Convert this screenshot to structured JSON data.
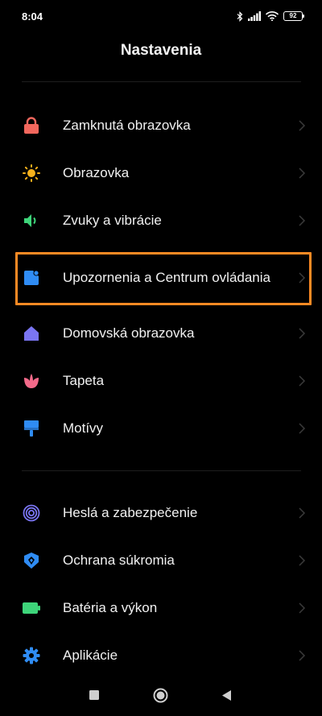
{
  "status_bar": {
    "time": "8:04",
    "battery_level": "92",
    "icons": [
      "bluetooth-icon",
      "signal-icon",
      "wifi-icon",
      "battery-icon"
    ]
  },
  "page_title": "Nastavenia",
  "groups": [
    {
      "items": [
        {
          "label": "Zamknutá obrazovka",
          "icon": "lock-icon",
          "icon_color": "#f2675d"
        },
        {
          "label": "Obrazovka",
          "icon": "sun-icon",
          "icon_color": "#f7b21c"
        },
        {
          "label": "Zvuky a vibrácie",
          "icon": "speaker-icon",
          "icon_color": "#3ed57a"
        },
        {
          "label": "Upozornenia a Centrum ovládania",
          "icon": "notification-icon",
          "icon_color": "#2f8cf4"
        },
        {
          "label": "Domovská obrazovka",
          "icon": "home-icon",
          "icon_color": "#7a75f2"
        },
        {
          "label": "Tapeta",
          "icon": "tulip-icon",
          "icon_color": "#f36a8a"
        },
        {
          "label": "Motívy",
          "icon": "brush-icon",
          "icon_color": "#2f8cf4"
        }
      ]
    },
    {
      "items": [
        {
          "label": "Heslá a zabezpečenie",
          "icon": "fingerprint-icon",
          "icon_color": "#7a75f2"
        },
        {
          "label": "Ochrana súkromia",
          "icon": "privacy-shield-icon",
          "icon_color": "#2f8cf4"
        },
        {
          "label": "Batéria a výkon",
          "icon": "battery-performance-icon",
          "icon_color": "#3ed57a"
        },
        {
          "label": "Aplikácie",
          "icon": "gear-icon",
          "icon_color": "#2f8cf4"
        }
      ]
    }
  ],
  "highlight_color": "#ff8a24",
  "nav_bar": {
    "buttons": [
      "recent-apps-icon",
      "home-button-icon",
      "back-icon"
    ]
  }
}
